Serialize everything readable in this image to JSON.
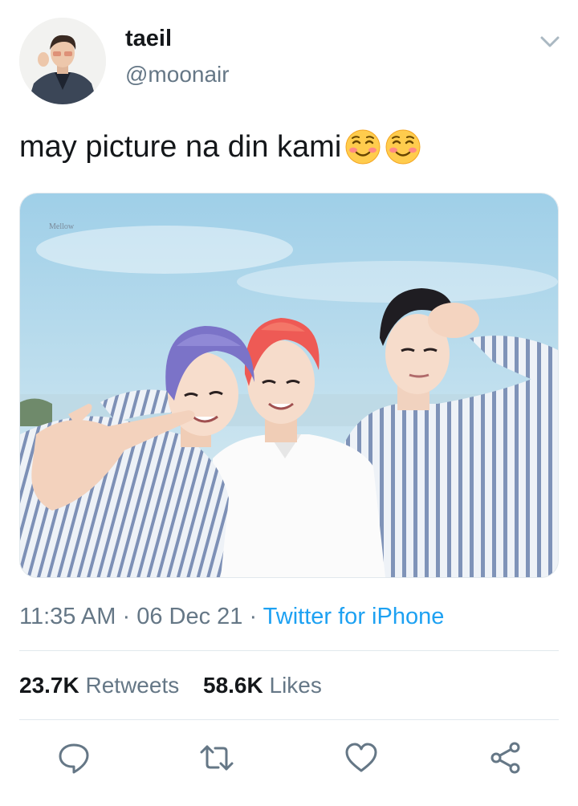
{
  "tweet": {
    "author": {
      "display_name": "taeil",
      "handle": "@moonair",
      "avatar": "profile-avatar"
    },
    "text": "may picture na din kami",
    "emojis": [
      "smiling-face-emoji",
      "smiling-face-emoji"
    ],
    "media": {
      "watermark": "Mellow",
      "description": "photo"
    },
    "meta": {
      "time": "11:35 AM",
      "separator": "·",
      "date": "06 Dec 21",
      "source": "Twitter for iPhone"
    },
    "stats": {
      "retweets_count": "23.7K",
      "retweets_label": "Retweets",
      "likes_count": "58.6K",
      "likes_label": "Likes"
    },
    "actions": [
      "reply-icon",
      "retweet-icon",
      "like-icon",
      "share-icon"
    ]
  },
  "colors": {
    "text_primary": "#14171a",
    "text_secondary": "#657786",
    "link": "#1da1f2",
    "divider": "#e1e8ed"
  }
}
